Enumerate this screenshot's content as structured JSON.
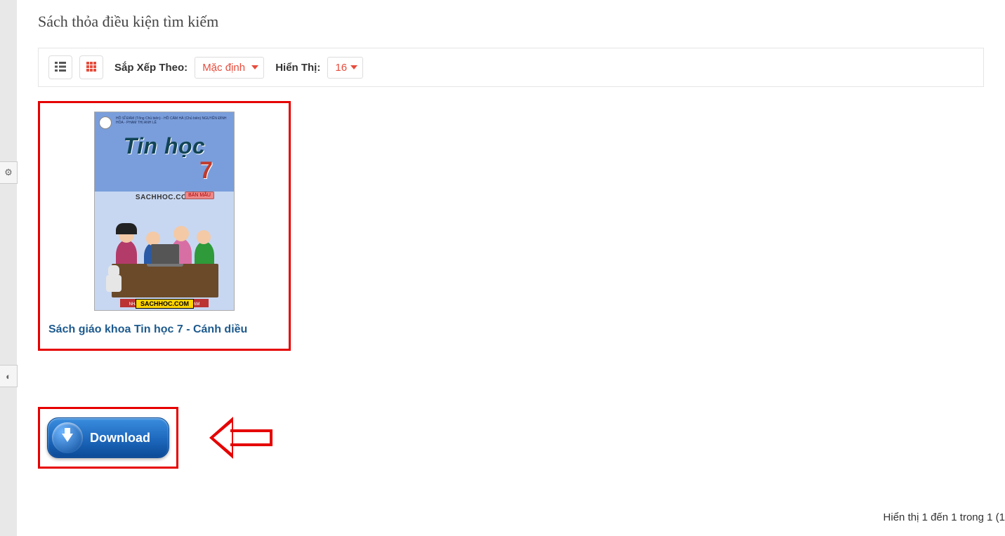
{
  "heading": "Sách thỏa điều kiện tìm kiếm",
  "toolbar": {
    "sort_label": "Sắp Xếp Theo:",
    "sort_selected": "Mặc định",
    "show_label": "Hiển Thị:",
    "show_selected": "16"
  },
  "product": {
    "cover": {
      "title": "Tin học",
      "grade": "7",
      "site": "SACHHOC.COM",
      "badge": "BẢN MẪU",
      "publisher": "NHÀ XUẤT BẢN ĐẠI HỌC SƯ PHẠM",
      "watermark": "SACHHOC.COM",
      "credits": "HỒ SĨ ĐÀM (Tổng Chủ biên) - HỒ CẨM HÀ (Chủ biên)\nNGUYỄN ĐÌNH HÓA - PHẠM THỊ ANH LÊ"
    },
    "title": "Sách giáo khoa Tin học 7 - Cánh diều"
  },
  "download_label": "Download",
  "pagination_text": "Hiển thị 1 đến 1 trong 1 (1"
}
